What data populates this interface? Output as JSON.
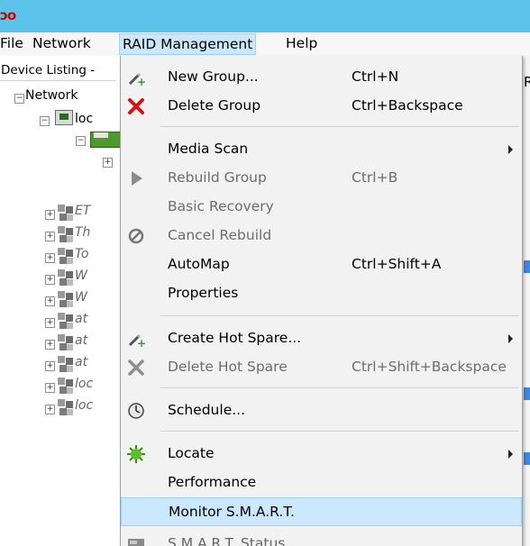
{
  "app": {
    "logo_text": "ɔo"
  },
  "menubar": {
    "items": [
      {
        "label": "File"
      },
      {
        "label": "Network"
      },
      {
        "label": "RAID Management"
      },
      {
        "label": "Help"
      }
    ]
  },
  "left_panel": {
    "tab_label": "Device Listing",
    "tree_root": "Network",
    "local_node": "loc",
    "items": [
      "ET",
      "Th",
      "To",
      "W",
      "W",
      "at",
      "at",
      "at",
      "loc",
      "loc"
    ]
  },
  "right_panel": {
    "header_char": "R"
  },
  "raid_menu": {
    "items": [
      {
        "label": "New Group...",
        "shortcut": "Ctrl+N",
        "icon": "wand-add-icon"
      },
      {
        "label": "Delete Group",
        "shortcut": "Ctrl+Backspace",
        "icon": "red-x-icon"
      },
      {
        "label": "Media Scan",
        "shortcut": "",
        "icon": "",
        "submenu": true
      },
      {
        "label": "Rebuild Group",
        "shortcut": "Ctrl+B",
        "icon": "play-icon",
        "disabled": true
      },
      {
        "label": "Basic Recovery",
        "shortcut": "",
        "icon": "",
        "disabled": true
      },
      {
        "label": "Cancel Rebuild",
        "shortcut": "",
        "icon": "no-entry-icon",
        "disabled": true
      },
      {
        "label": "AutoMap",
        "shortcut": "Ctrl+Shift+A",
        "icon": ""
      },
      {
        "label": "Properties",
        "shortcut": "",
        "icon": ""
      },
      {
        "label": "Create Hot Spare...",
        "shortcut": "",
        "icon": "wand-add-icon",
        "submenu": true
      },
      {
        "label": "Delete Hot Spare",
        "shortcut": "Ctrl+Shift+Backspace",
        "icon": "grey-x-icon",
        "disabled": true
      },
      {
        "label": "Schedule...",
        "shortcut": "",
        "icon": "clock-icon"
      },
      {
        "label": "Locate",
        "shortcut": "",
        "icon": "locate-icon",
        "submenu": true
      },
      {
        "label": "Performance",
        "shortcut": "",
        "icon": ""
      },
      {
        "label": "Monitor S.M.A.R.T.",
        "shortcut": "",
        "icon": "",
        "highlighted": true
      },
      {
        "label": "S.M.A.R.T. Status",
        "shortcut": "",
        "icon": "drive-icon"
      }
    ]
  }
}
